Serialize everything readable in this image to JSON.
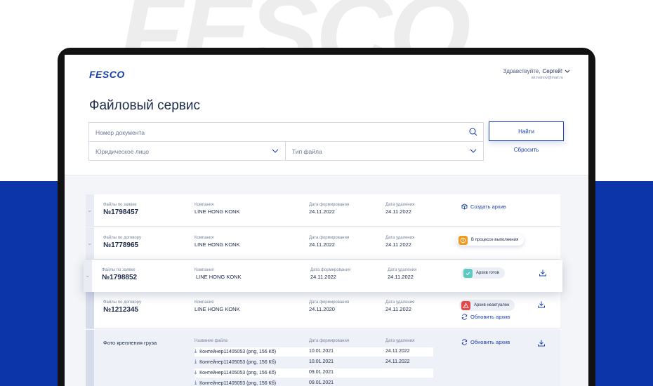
{
  "background_logo": "FESCO",
  "app": {
    "logo": "FESCO",
    "greeting_prefix": "Здравствуйте,",
    "user_name": "Сергей!",
    "user_email": "ak.ivanov@mail.ru"
  },
  "page_title": "Файловый сервис",
  "search": {
    "doc_number_placeholder": "Номер документа",
    "legal_entity_placeholder": "Юридическое лицо",
    "file_type_placeholder": "Тип файла",
    "find_label": "Найти",
    "reset_label": "Сбросить"
  },
  "rows": [
    {
      "type_label": "Файлы по заявке",
      "number": "№1798457",
      "company_label": "Компания",
      "company": "LINE HONG KONK",
      "formed_label": "Дата формирования",
      "formed": "24.11.2022",
      "deleted_label": "Дата удаления",
      "deleted": "24.11.2022",
      "action": "Создать архив"
    },
    {
      "type_label": "Файлы по договору",
      "number": "№1778965",
      "company_label": "Компания",
      "company": "LINE HONG KONK",
      "formed_label": "Дата формирования",
      "formed": "24.11.2022",
      "deleted_label": "Дата удаления",
      "deleted": "24.11.2022",
      "status": "В процессе выполнения"
    },
    {
      "type_label": "Файлы по заявке",
      "number": "№1798852",
      "company_label": "Компания",
      "company": "LINE HONG KONK",
      "formed_label": "Дата формирования",
      "formed": "24.11.2022",
      "deleted_label": "Дата удаления",
      "deleted": "24.11.2022",
      "status": "Архив готов"
    },
    {
      "type_label": "Файлы по договору",
      "number": "№1212345",
      "company_label": "Компания",
      "company": "LINE HONG KONK",
      "formed_label": "Дата формирования",
      "formed": "24.11.2020",
      "deleted_label": "Дата удаления",
      "deleted": "24.11.2022",
      "status": "Архив неактуален",
      "action": "Обновить архив"
    }
  ],
  "expanded": {
    "group_title": "Фото крепления груза",
    "name_label": "Название файла",
    "formed_label": "Дата формирования",
    "deleted_label": "Дата удаления",
    "action": "Обновить архив",
    "files": [
      {
        "name": "Контейнер11405053 (png, 156 Кб)",
        "formed": "10.01.2021",
        "deleted": "24.11.2022"
      },
      {
        "name": "Контейнер11405053 (png, 156 Кб)",
        "formed": "10.01.2021",
        "deleted": "24.11.2022"
      },
      {
        "name": "Контейнер11405053 (png, 156 Кб)",
        "formed": "09.01.2021",
        "deleted": ""
      },
      {
        "name": "Контейнер11405053 (png, 156 Кб)",
        "formed": "09.01.2021",
        "deleted": ""
      }
    ]
  },
  "colors": {
    "brand_blue": "#1a3fb0",
    "band_blue": "#0b35a8",
    "status_progress": "#f39a1e",
    "status_ready": "#5ec9c0",
    "status_stale": "#e64848"
  }
}
